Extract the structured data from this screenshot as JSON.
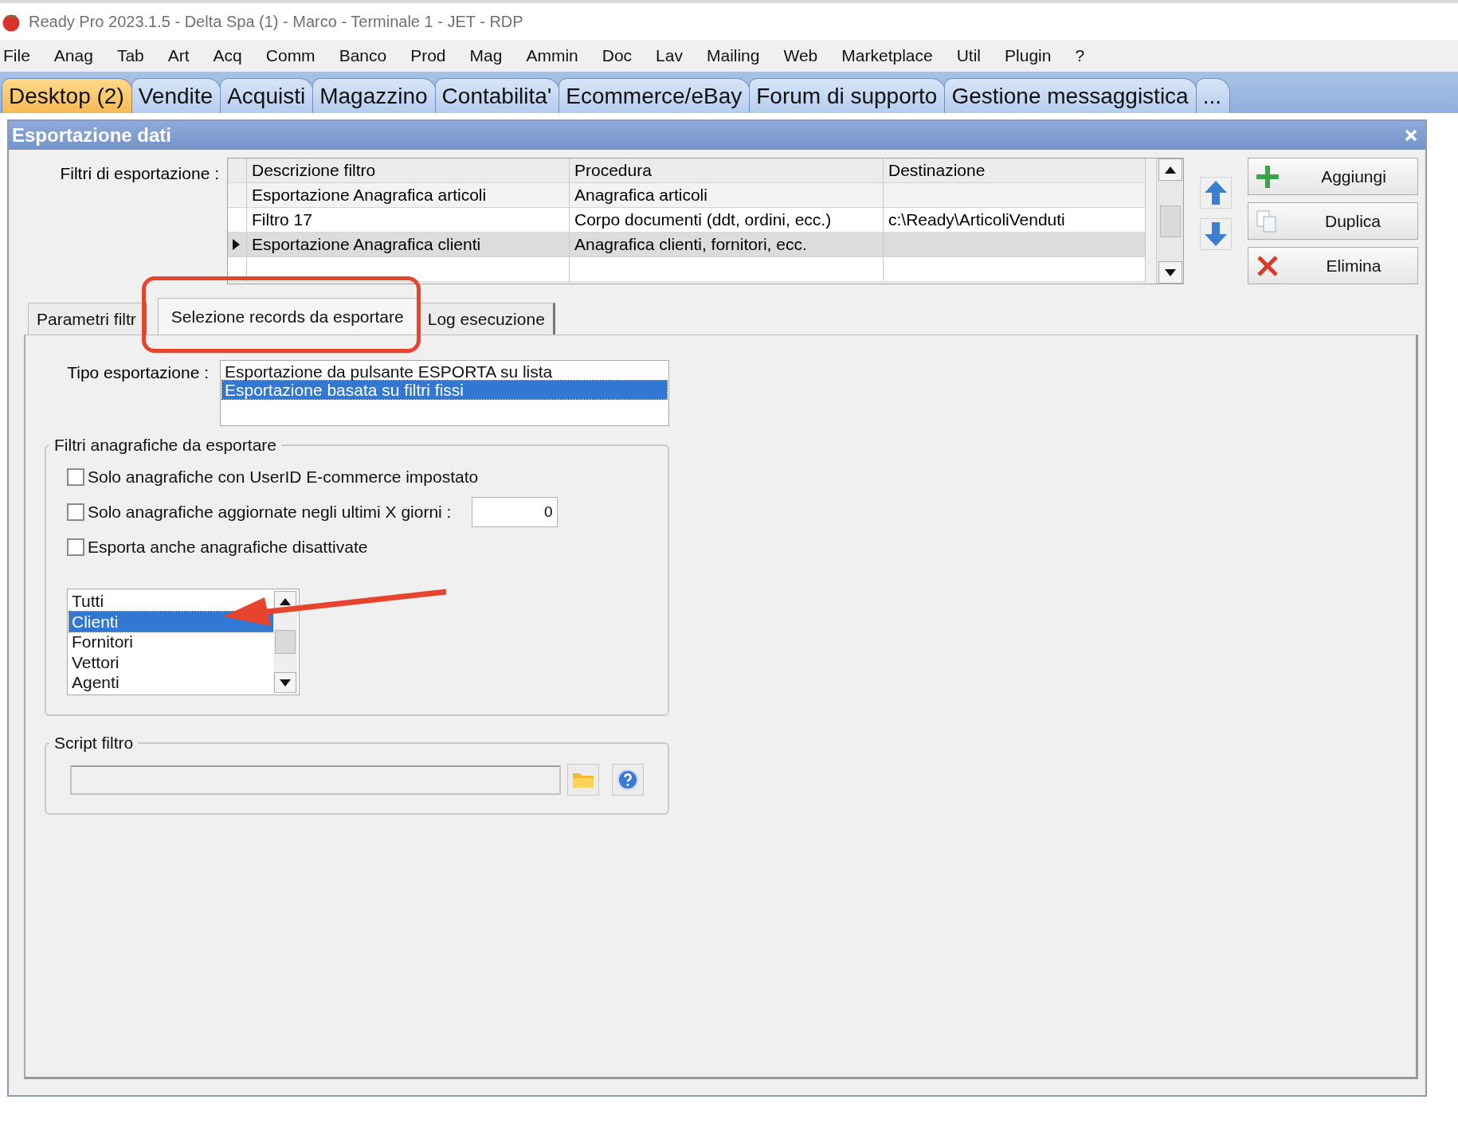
{
  "window": {
    "title": "Ready Pro 2023.1.5 - Delta Spa (1) - Marco - Terminale 1 - JET - RDP"
  },
  "menu": [
    "File",
    "Anag",
    "Tab",
    "Art",
    "Acq",
    "Comm",
    "Banco",
    "Prod",
    "Mag",
    "Ammin",
    "Doc",
    "Lav",
    "Mailing",
    "Web",
    "Marketplace",
    "Util",
    "Plugin",
    "?"
  ],
  "app_tabs": [
    {
      "label": "Desktop (2)",
      "selected": true
    },
    {
      "label": "Vendite",
      "selected": false
    },
    {
      "label": "Acquisti",
      "selected": false
    },
    {
      "label": "Magazzino",
      "selected": false
    },
    {
      "label": "Contabilita'",
      "selected": false
    },
    {
      "label": "Ecommerce/eBay",
      "selected": false
    },
    {
      "label": "Forum di supporto",
      "selected": false
    },
    {
      "label": "Gestione messaggistica",
      "selected": false
    },
    {
      "label": "...",
      "selected": false
    }
  ],
  "dialog": {
    "title": "Esportazione dati",
    "filters_label": "Filtri di esportazione :",
    "table": {
      "columns": [
        "Descrizione filtro",
        "Procedura",
        "Destinazione"
      ],
      "rows": [
        {
          "cells": [
            "Esportazione Anagrafica articoli",
            "Anagrafica articoli",
            ""
          ],
          "selected": false
        },
        {
          "cells": [
            "Filtro 17",
            "Corpo documenti (ddt, ordini, ecc.)",
            "c:\\Ready\\ArticoliVenduti"
          ],
          "selected": false
        },
        {
          "cells": [
            "Esportazione Anagrafica clienti",
            "Anagrafica clienti, fornitori, ecc.",
            ""
          ],
          "selected": true
        }
      ]
    },
    "buttons": [
      {
        "label": "Aggiungi",
        "kind": "add"
      },
      {
        "label": "Duplica",
        "kind": "duplicate"
      },
      {
        "label": "Elimina",
        "kind": "delete"
      }
    ],
    "tabs": [
      {
        "label": "Parametri filtr",
        "selected": false
      },
      {
        "label": "Selezione records da esportare",
        "selected": true
      },
      {
        "label": "Log esecuzione",
        "selected": false
      }
    ],
    "export_type": {
      "label": "Tipo esportazione :",
      "options": [
        {
          "label": "Esportazione da pulsante ESPORTA su lista",
          "selected": false
        },
        {
          "label": "Esportazione basata su filtri fissi",
          "selected": true
        }
      ]
    },
    "filters_group": {
      "title": "Filtri anagrafiche da esportare",
      "checks": [
        {
          "kind": "plain",
          "label": "Solo anagrafiche con UserID E-commerce impostato",
          "checked": false
        },
        {
          "kind": "days",
          "label": "Solo anagrafiche aggiornate negli ultimi X giorni :",
          "checked": false,
          "value": "0"
        },
        {
          "kind": "plain",
          "label": "Esporta anche anagrafiche disattivate",
          "checked": false
        }
      ],
      "list": [
        {
          "label": "Tutti",
          "selected": false
        },
        {
          "label": "Clienti",
          "selected": true
        },
        {
          "label": "Fornitori",
          "selected": false
        },
        {
          "label": "Vettori",
          "selected": false
        },
        {
          "label": "Agenti",
          "selected": false
        }
      ]
    },
    "script_group": {
      "title": "Script filtro"
    }
  },
  "annotations": {
    "highlight_frame": true,
    "arrow": true
  }
}
